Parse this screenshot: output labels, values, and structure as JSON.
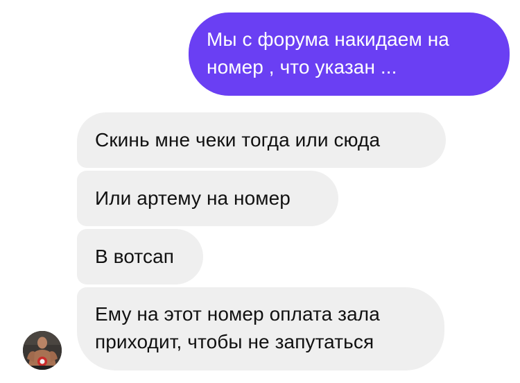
{
  "chat": {
    "messages": [
      {
        "direction": "outgoing",
        "text": "Мы с форума накидаем на\nномер , что указан ..."
      },
      {
        "direction": "incoming",
        "text": "Скинь мне чеки тогда или сюда"
      },
      {
        "direction": "incoming",
        "text": "Или артему на номер"
      },
      {
        "direction": "incoming",
        "text": "В вотсап"
      },
      {
        "direction": "incoming",
        "text": "Ему на этот номер оплата зала\nприходит, чтобы не запутаться"
      }
    ]
  },
  "colors": {
    "outgoing_bubble": "#6a3ff3",
    "incoming_bubble": "#efefef",
    "outgoing_text": "#ffffff",
    "incoming_text": "#111111"
  },
  "icons": {
    "avatar": "contact-avatar-photo"
  }
}
